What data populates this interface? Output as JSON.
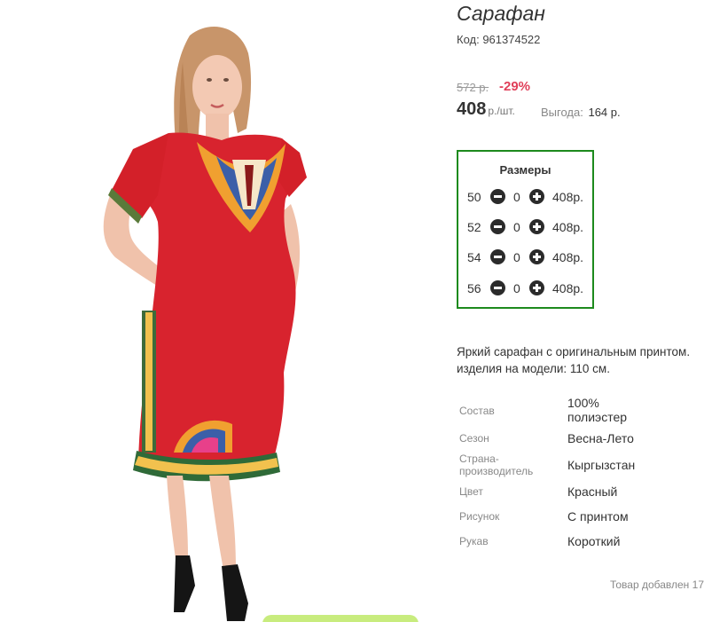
{
  "product": {
    "title": "Сарафан",
    "code_label": "Код: 961374522",
    "old_price": "572 р.",
    "discount": "-29%",
    "price": "408",
    "price_unit": "р./шт.",
    "savings_label": "Выгода:",
    "savings_value": "164 р."
  },
  "sizes": {
    "title": "Размеры",
    "items": [
      {
        "size": "50",
        "qty": "0",
        "price": "408р."
      },
      {
        "size": "52",
        "qty": "0",
        "price": "408р."
      },
      {
        "size": "54",
        "qty": "0",
        "price": "408р."
      },
      {
        "size": "56",
        "qty": "0",
        "price": "408р."
      }
    ]
  },
  "description": {
    "line1": "Яркий сарафан с оригинальным принтом.",
    "line2": "изделия на модели: 110 см."
  },
  "specs": [
    {
      "label": "Состав",
      "value": "100% полиэстер"
    },
    {
      "label": "Сезон",
      "value": "Весна-Лето"
    },
    {
      "label": "Страна-производитель",
      "value": "Кыргызстан"
    },
    {
      "label": "Цвет",
      "value": "Красный"
    },
    {
      "label": "Рисунок",
      "value": "С принтом"
    },
    {
      "label": "Рукав",
      "value": "Короткий"
    }
  ],
  "added_note": "Товар добавлен 17",
  "colors": {
    "discount": "#e0405a",
    "sizes_border": "#1d8a1d",
    "dress": "#d8232e",
    "cta": "#c8ec7e"
  },
  "icons": {
    "minus": "minus-circle-icon",
    "plus": "plus-circle-icon"
  }
}
